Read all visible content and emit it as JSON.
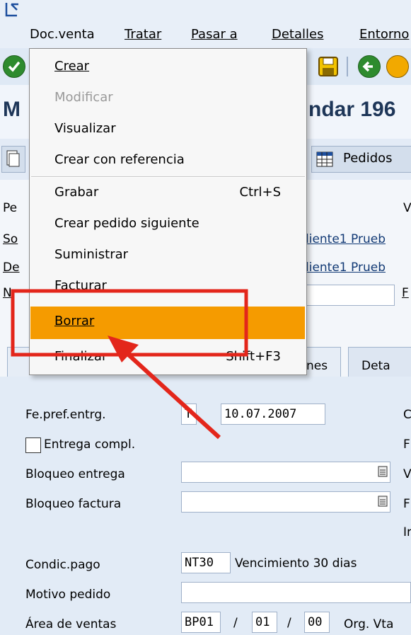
{
  "menubar": {
    "items": [
      "Doc.venta",
      "Tratar",
      "Pasar a",
      "Detalles",
      "Entorno"
    ]
  },
  "title": {
    "text": "M",
    "text_right": "ndar 196"
  },
  "app_toolbar": {
    "pedidos_label": "Pedidos"
  },
  "header": {
    "row1": {
      "label": "Pe",
      "right": "V"
    },
    "row2": {
      "label": "So",
      "value": "liente1 Prueb"
    },
    "row3": {
      "label": "De",
      "value": "liente1 Prueb"
    },
    "row4": {
      "label": "N",
      "right": "F"
    }
  },
  "tabs": {
    "tab1_suffix": "nes",
    "tab2": "Deta"
  },
  "dropdown": {
    "items": [
      {
        "label": "Crear"
      },
      {
        "label": "Modificar"
      },
      {
        "label": "Visualizar"
      },
      {
        "label": "Crear con referencia"
      },
      {
        "label": "Grabar",
        "shortcut": "Ctrl+S"
      },
      {
        "label": "Crear pedido siguiente"
      },
      {
        "label": "Suministrar"
      },
      {
        "label": "Facturar"
      },
      {
        "label": "Borrar"
      },
      {
        "label": "Finalizar",
        "shortcut": "Shift+F3"
      }
    ]
  },
  "form": {
    "fe_pref_entrg": {
      "label": "Fe.pref.entrg.",
      "type": "T",
      "date": "10.07.2007"
    },
    "entrega_compl": {
      "label": "Entrega compl."
    },
    "bloqueo_entrega": {
      "label": "Bloqueo entrega"
    },
    "bloqueo_factura": {
      "label": "Bloqueo factura"
    },
    "condic_pago": {
      "label": "Condic.pago",
      "code": "NT30",
      "text": "Vencimiento 30 dias"
    },
    "motivo_pedido": {
      "label": "Motivo pedido"
    },
    "area_ventas": {
      "label": "Área de ventas",
      "org": "BP01",
      "canal": "01",
      "sector": "00",
      "org_text": "Org. Vta"
    },
    "right_letters": [
      "C",
      "F",
      "V",
      "F",
      "Ir"
    ]
  },
  "colors": {
    "highlight": "#f59b00",
    "annotation": "#e3261b"
  }
}
